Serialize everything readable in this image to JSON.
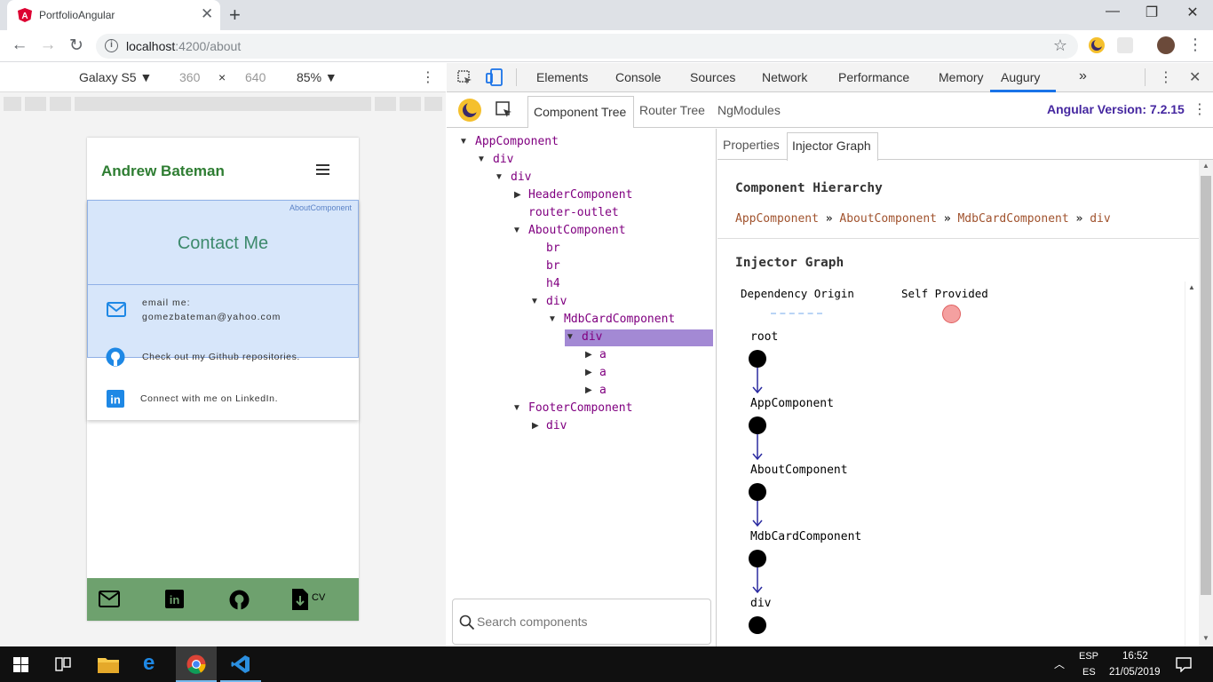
{
  "browser": {
    "tab_title": "PortfolioAngular",
    "url_host": "localhost",
    "url_rest": ":4200/about"
  },
  "device_toolbar": {
    "device": "Galaxy S5 ▼",
    "width": "360",
    "times": "×",
    "height": "640",
    "zoom": "85% ▼"
  },
  "site": {
    "brand": "Andrew Bateman",
    "component_overlay_label": "AboutComponent",
    "contact_title": "Contact Me",
    "email_label": "email me:",
    "email_value": "gomezbateman@yahoo.com",
    "github_text": "Check out my Github repositories.",
    "linkedin_text": "Connect with me on LinkedIn.",
    "cv_label": "CV"
  },
  "devtools": {
    "tabs": [
      "Elements",
      "Console",
      "Sources",
      "Network",
      "Performance",
      "Memory",
      "Augury"
    ],
    "more": "»",
    "active_tab": "Augury"
  },
  "augury": {
    "subtabs": [
      "Component Tree",
      "Router Tree",
      "NgModules"
    ],
    "active_subtab": "Component Tree",
    "angular_version": "Angular Version: 7.2.15",
    "search_placeholder": "Search components",
    "tree": [
      {
        "label": "AppComponent",
        "depth": 0,
        "toggle": "down"
      },
      {
        "label": "div",
        "depth": 1,
        "toggle": "down"
      },
      {
        "label": "div",
        "depth": 2,
        "toggle": "down"
      },
      {
        "label": "HeaderComponent",
        "depth": 3,
        "toggle": "right"
      },
      {
        "label": "router-outlet",
        "depth": 3,
        "toggle": "none"
      },
      {
        "label": "AboutComponent",
        "depth": 3,
        "toggle": "down"
      },
      {
        "label": "br",
        "depth": 4,
        "toggle": "none"
      },
      {
        "label": "br",
        "depth": 4,
        "toggle": "none"
      },
      {
        "label": "h4",
        "depth": 4,
        "toggle": "none"
      },
      {
        "label": "div",
        "depth": 4,
        "toggle": "down"
      },
      {
        "label": "MdbCardComponent",
        "depth": 5,
        "toggle": "down"
      },
      {
        "label": "div",
        "depth": 6,
        "toggle": "down",
        "selected": true
      },
      {
        "label": "a",
        "depth": 7,
        "toggle": "right"
      },
      {
        "label": "a",
        "depth": 7,
        "toggle": "right"
      },
      {
        "label": "a",
        "depth": 7,
        "toggle": "right"
      },
      {
        "label": "FooterComponent",
        "depth": 3,
        "toggle": "down"
      },
      {
        "label": "div",
        "depth": 4,
        "toggle": "right"
      }
    ],
    "right_tabs": [
      "Properties",
      "Injector Graph"
    ],
    "active_right_tab": "Injector Graph",
    "hierarchy_title": "Component Hierarchy",
    "breadcrumb": [
      "AppComponent",
      "AboutComponent",
      "MdbCardComponent",
      "div"
    ],
    "breadcrumb_sep": "»",
    "injector_title": "Injector Graph",
    "legend_origin": "Dependency Origin",
    "legend_self": "Self Provided",
    "graph_nodes": [
      "root",
      "AppComponent",
      "AboutComponent",
      "MdbCardComponent",
      "div"
    ]
  },
  "taskbar": {
    "lang1": "ESP",
    "lang2": "ES",
    "time": "16:52",
    "date": "21/05/2019"
  },
  "colors": {
    "brand_green": "#2e7d32",
    "footer_green": "#6ea16e",
    "tree_purple": "#800080",
    "selected_row": "#a389d4",
    "breadcrumb_brown": "#a0522d",
    "version_purple": "#4527a0",
    "edge_blue": "#2a2aa0",
    "overlay_blue": "#a6c8f5"
  }
}
